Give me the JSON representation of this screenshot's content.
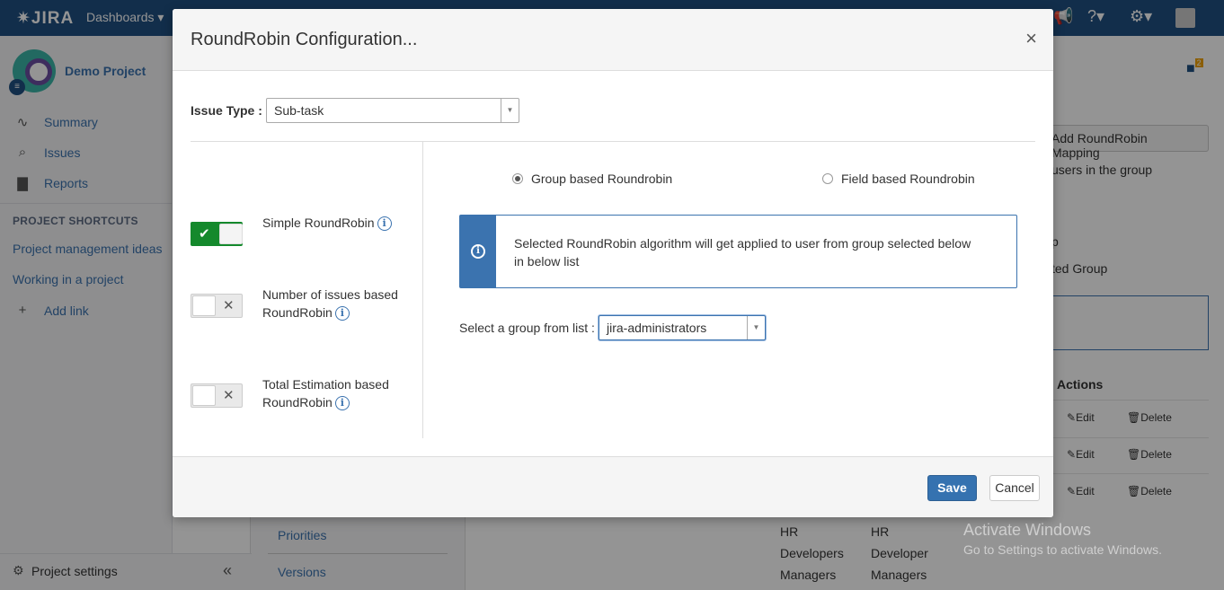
{
  "topnav": {
    "logo": "JIRA",
    "dashboards_label": "Dashboards ▾"
  },
  "sidebar": {
    "project_name": "Demo Project",
    "items": [
      {
        "label": "Summary"
      },
      {
        "label": "Issues"
      },
      {
        "label": "Reports"
      }
    ],
    "shortcuts_heading": "PROJECT SHORTCUTS",
    "shortcuts": [
      {
        "label": "Project management ideas"
      },
      {
        "label": "Working in a project"
      },
      {
        "label": "Add link"
      }
    ],
    "settings_label": "Project settings",
    "collapse_glyph": "«"
  },
  "background": {
    "add_mapping_label": "Add RoundRobin Mapping",
    "users_in_group": "users in the group",
    "frag_p": "p",
    "frag_ted_group": "ted Group",
    "actions_heading": "Actions",
    "edit_label": "Edit",
    "delete_label": "Delete",
    "priorities": "Priorities",
    "versions": "Versions",
    "col1": [
      "HR",
      "Developers",
      "Managers"
    ],
    "col2": [
      "HR",
      "Developer",
      "Managers"
    ],
    "notification_count": "2"
  },
  "modal": {
    "title": "RoundRobin Configuration...",
    "close_glyph": "×",
    "issue_type_label": "Issue Type :",
    "issue_type_value": "Sub-task",
    "options": [
      {
        "line1": "Simple RoundRobin",
        "line2": ""
      },
      {
        "line1": "Number of issues based",
        "line2": "RoundRobin"
      },
      {
        "line1": "Total Estimation based",
        "line2": "RoundRobin"
      }
    ],
    "radio_group": "Group based Roundrobin",
    "radio_field": "Field based Roundrobin",
    "info_message": "Selected RoundRobin algorithm will get applied to user from group selected below in below list",
    "group_select_label": "Select a group from list :",
    "group_select_value": "jira-administrators",
    "save_label": "Save",
    "cancel_label": "Cancel"
  },
  "watermark": {
    "line1": "Activate Windows",
    "line2": "Go to Settings to activate Windows."
  }
}
